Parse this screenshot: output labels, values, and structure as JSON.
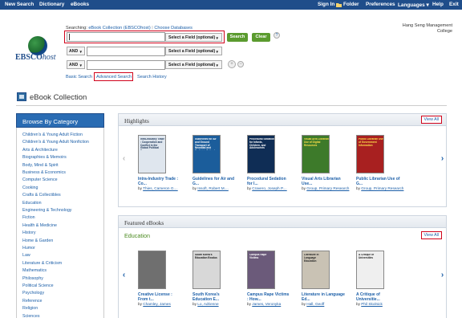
{
  "topbar": {
    "left": [
      "New Search",
      "Dictionary",
      "eBooks"
    ],
    "right": [
      "Sign In",
      "Folder",
      "Preferences",
      "Languages ▾",
      "Help",
      "Exit"
    ]
  },
  "org_name": "Hang Seng Management College",
  "logo": {
    "brand": "EBSCO",
    "brand_suffix": "host"
  },
  "search": {
    "searching_prefix": "Searching:",
    "collection": "eBook Collection (EBSCOhost)",
    "choose_db": "Choose Databases",
    "row1_value": "",
    "field_select": "Select a Field (optional)",
    "bool_ops": [
      "AND",
      "AND"
    ],
    "search_button": "Search",
    "clear_button": "Clear",
    "help": "?",
    "add": "+",
    "remove": "−",
    "links": [
      "Basic Search",
      "Advanced Search",
      "Search History"
    ]
  },
  "page_title": "eBook Collection",
  "categories": {
    "title": "Browse By Category",
    "items": [
      "Children's & Young Adult Fiction",
      "Children's & Young Adult Nonfiction",
      "Arts & Architecture",
      "Biographies & Memoirs",
      "Body, Mind & Spirit",
      "Business & Economics",
      "Computer Science",
      "Cooking",
      "Crafts & Collectibles",
      "Education",
      "Engineering & Technology",
      "Fiction",
      "Health & Medicine",
      "History",
      "Home & Garden",
      "Humor",
      "Law",
      "Literature & Criticism",
      "Mathematics",
      "Philosophy",
      "Political Science",
      "Psychology",
      "Reference",
      "Religion",
      "Sciences"
    ]
  },
  "highlights": {
    "title": "Highlights",
    "view_all": "View All",
    "books": [
      {
        "cover_text": "Intra-Industry Trade : Cooperation and Conflict in the Global Political Economy",
        "title": "Intra-Industry Trade : Co...",
        "by": "by",
        "author": "Thies, Cameron G....",
        "cover_bg": "#dfe6ee",
        "cover_fg": "#213a5c"
      },
      {
        "cover_text": "Guidelines for Air and Ground Transport of Neonatal and Pediatric Patients",
        "title": "Guidelines for Air and G...",
        "by": "by",
        "author": "Insoft, Robert M....",
        "cover_bg": "#1b5d9b",
        "cover_fg": "#ffffff"
      },
      {
        "cover_text": "Procedural Sedation for Infants, Children, and Adolescents",
        "title": "Procedural Sedation for I...",
        "by": "by",
        "author": "Cravero, Joseph P....",
        "cover_bg": "#0f2d55",
        "cover_fg": "#ffffff"
      },
      {
        "cover_text": "Visual Arts Librarian Use of Digital Resources",
        "title": "Visual Arts Librarian Use...",
        "by": "by",
        "author": "Group, Primary Research",
        "cover_bg": "#3d7a2a",
        "cover_fg": "#ffe04a"
      },
      {
        "cover_text": "Public Librarian Use of Government Information",
        "title": "Public Librarian Use of G...",
        "by": "by",
        "author": "Group, Primary Research",
        "cover_bg": "#a82020",
        "cover_fg": "#ffe04a"
      }
    ]
  },
  "featured": {
    "title": "Featured eBooks",
    "subtitle": "Education",
    "view_all": "View All",
    "books": [
      {
        "cover_text": "",
        "title": "Creative License : From t...",
        "by": "by",
        "author": "Chamley, James",
        "cover_bg": "#6f6f6f",
        "cover_fg": "#ffffff"
      },
      {
        "cover_text": "South Korea's Education Exodus",
        "title": "South Korea's Education E...",
        "by": "by",
        "author": "Lo, Adrienne",
        "cover_bg": "#d8d8d8",
        "cover_fg": "#111111"
      },
      {
        "cover_text": "Campus Rape Victims",
        "title": "Campus Rape Victims : How...",
        "by": "by",
        "author": "James, Veronyka",
        "cover_bg": "#6b5a7a",
        "cover_fg": "#ffffff"
      },
      {
        "cover_text": "Literature in Language Education",
        "title": "Literature in Language Ed...",
        "by": "by",
        "author": "Hall, Geoff",
        "cover_bg": "#c9c2b4",
        "cover_fg": "#222222"
      },
      {
        "cover_text": "A Critique of Universities",
        "title": "A Critique of Universitie...",
        "by": "by",
        "author": "Phil Skolnick",
        "cover_bg": "#efefef",
        "cover_fg": "#222222"
      }
    ]
  },
  "colors": {
    "topbar": "#1f4d8a",
    "link": "#1c5fa8",
    "green": "#5b9b2f",
    "highlight_red": "#d0021b"
  }
}
